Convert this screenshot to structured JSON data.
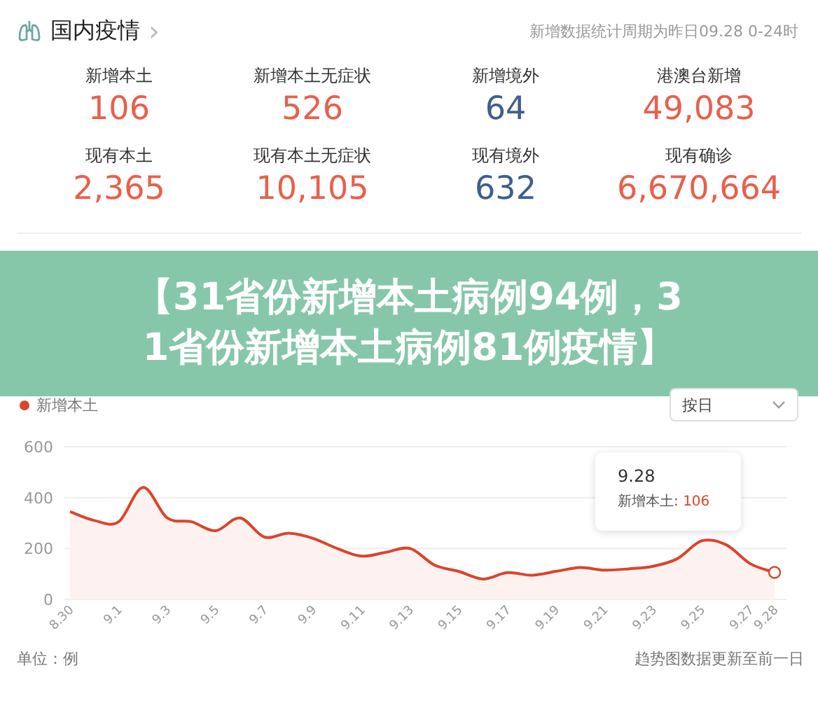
{
  "header": {
    "title": "国内疫情",
    "chevron": "›",
    "note": "新增数据统计周期为昨日09.28 0-24时"
  },
  "stats": [
    {
      "label": "新增本土",
      "value": "106",
      "color": "#e8604c"
    },
    {
      "label": "新增本土无症状",
      "value": "526",
      "color": "#e8604c"
    },
    {
      "label": "新增境外",
      "value": "64",
      "color": "#3d5f8f"
    },
    {
      "label": "港澳台新增",
      "value": "49,083",
      "color": "#e8604c"
    },
    {
      "label": "现有本土",
      "value": "2,365",
      "color": "#e8604c"
    },
    {
      "label": "现有本土无症状",
      "value": "10,105",
      "color": "#e8604c"
    },
    {
      "label": "现有境外",
      "value": "632",
      "color": "#3d5f8f"
    },
    {
      "label": "现有确诊",
      "value": "6,670,664",
      "color": "#e8604c"
    }
  ],
  "banner": {
    "lines": [
      "【31省份新增本土病例94例，3",
      "1省份新增本土病例81例疫情】"
    ]
  },
  "period_select": {
    "value": "按日"
  },
  "trend": {
    "chart_data": {
      "type": "area",
      "categories": [
        "8.30",
        null,
        "9.1",
        null,
        "9.3",
        null,
        "9.5",
        null,
        "9.7",
        null,
        "9.9",
        null,
        "9.11",
        null,
        "9.13",
        null,
        "9.15",
        null,
        "9.17",
        null,
        "9.19",
        null,
        "9.21",
        null,
        "9.23",
        null,
        "9.25",
        null,
        "9.27",
        "9.28"
      ],
      "series": [
        {
          "name": "新增本土",
          "color": "#d9452b",
          "values": [
            345,
            310,
            305,
            440,
            320,
            305,
            270,
            320,
            245,
            260,
            240,
            200,
            170,
            185,
            200,
            135,
            110,
            80,
            105,
            95,
            110,
            125,
            115,
            120,
            130,
            160,
            230,
            215,
            140,
            106
          ]
        }
      ],
      "ylim": [
        0,
        600
      ],
      "yticks": [
        0,
        200,
        400,
        600
      ]
    },
    "tooltip": {
      "title": "9.28",
      "label": "新增本土:",
      "value": "106"
    }
  },
  "footer": {
    "unit": "单位：例",
    "note": "趋势图数据更新至前一日"
  }
}
